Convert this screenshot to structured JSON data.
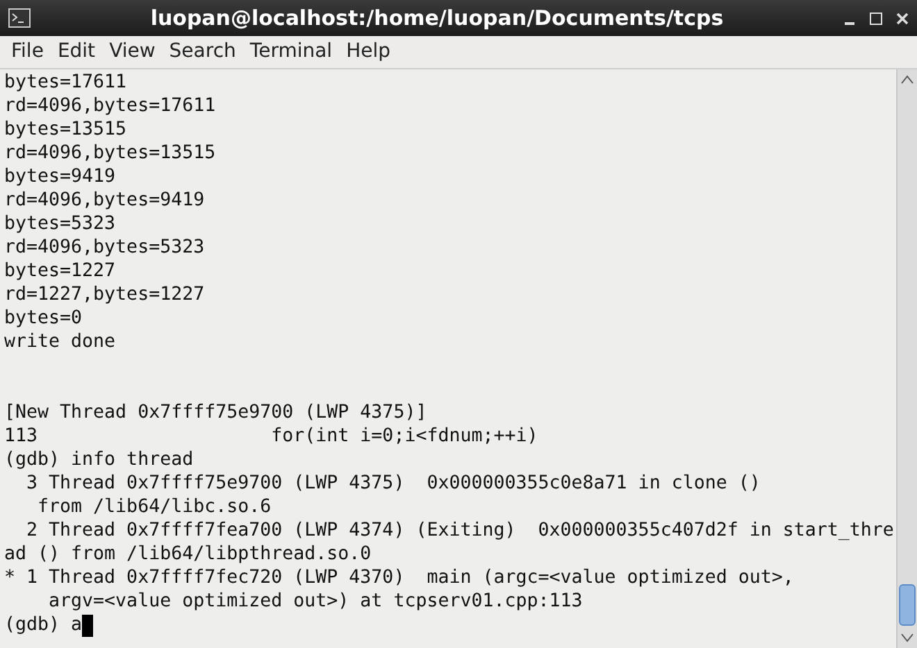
{
  "window": {
    "title": "luopan@localhost:/home/luopan/Documents/tcps"
  },
  "menu": [
    "File",
    "Edit",
    "View",
    "Search",
    "Terminal",
    "Help"
  ],
  "terminal": {
    "output": [
      "bytes=17611",
      "rd=4096,bytes=17611",
      "bytes=13515",
      "rd=4096,bytes=13515",
      "bytes=9419",
      "rd=4096,bytes=9419",
      "bytes=5323",
      "rd=4096,bytes=5323",
      "bytes=1227",
      "rd=1227,bytes=1227",
      "bytes=0",
      "write done"
    ],
    "session": [
      "[New Thread 0x7ffff75e9700 (LWP 4375)]",
      "113                     for(int i=0;i<fdnum;++i)",
      "(gdb) info thread",
      "  3 Thread 0x7ffff75e9700 (LWP 4375)  0x000000355c0e8a71 in clone ()",
      "   from /lib64/libc.so.6",
      "  2 Thread 0x7ffff7fea700 (LWP 4374) (Exiting)  0x000000355c407d2f in start_thre",
      "ad () from /lib64/libpthread.so.0",
      "* 1 Thread 0x7ffff7fec720 (LWP 4370)  main (argc=<value optimized out>,",
      "    argv=<value optimized out>) at tcpserv01.cpp:113"
    ],
    "prompt": "(gdb) a"
  }
}
